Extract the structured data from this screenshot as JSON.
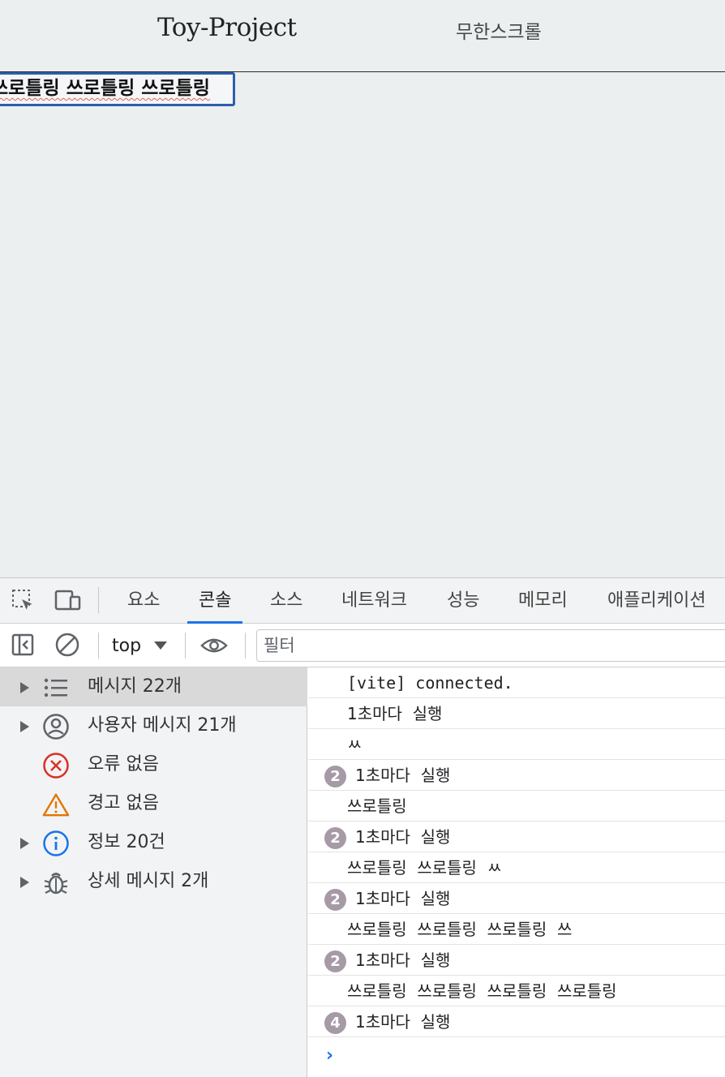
{
  "site": {
    "title": "Toy-Project",
    "nav_link": "무한스크롤",
    "typing_text": "쓰로틀링 쓰로틀링 쓰로틀링"
  },
  "devtools": {
    "tabs": [
      {
        "label": "요소"
      },
      {
        "label": "콘솔",
        "active": true
      },
      {
        "label": "소스"
      },
      {
        "label": "네트워크"
      },
      {
        "label": "성능"
      },
      {
        "label": "메모리"
      },
      {
        "label": "애플리케이션"
      }
    ],
    "context_selector": "top",
    "filter_placeholder": "필터",
    "sidebar": [
      {
        "label": "메시지 22개",
        "icon": "list-icon",
        "expandable": true,
        "selected": true
      },
      {
        "label": "사용자 메시지 21개",
        "icon": "user-circle-icon",
        "expandable": true
      },
      {
        "label": "오류 없음",
        "icon": "error-icon",
        "expandable": false
      },
      {
        "label": "경고 없음",
        "icon": "warning-icon",
        "expandable": false
      },
      {
        "label": "정보 20건",
        "icon": "info-icon",
        "expandable": true
      },
      {
        "label": "상세 메시지 2개",
        "icon": "bug-icon",
        "expandable": true
      }
    ],
    "console_logs": [
      {
        "text": "[vite] connected.",
        "mono": true
      },
      {
        "text": "1초마다  실행"
      },
      {
        "text": "ㅆ"
      },
      {
        "text": "1초마다  실행",
        "count": "2"
      },
      {
        "text": "쓰로틀링"
      },
      {
        "text": "1초마다  실행",
        "count": "2"
      },
      {
        "text": "쓰로틀링  쓰로틀링  ㅆ"
      },
      {
        "text": "1초마다  실행",
        "count": "2"
      },
      {
        "text": "쓰로틀링  쓰로틀링  쓰로틀링  쓰"
      },
      {
        "text": "1초마다  실행",
        "count": "2"
      },
      {
        "text": "쓰로틀링  쓰로틀링  쓰로틀링  쓰로틀링"
      },
      {
        "text": "1초마다  실행",
        "count": "4"
      }
    ],
    "prompt_symbol": "›",
    "colors": {
      "accent": "#1a73e8",
      "badge": "#a69aa6",
      "error": "#d93025",
      "warning": "#e37400"
    }
  }
}
